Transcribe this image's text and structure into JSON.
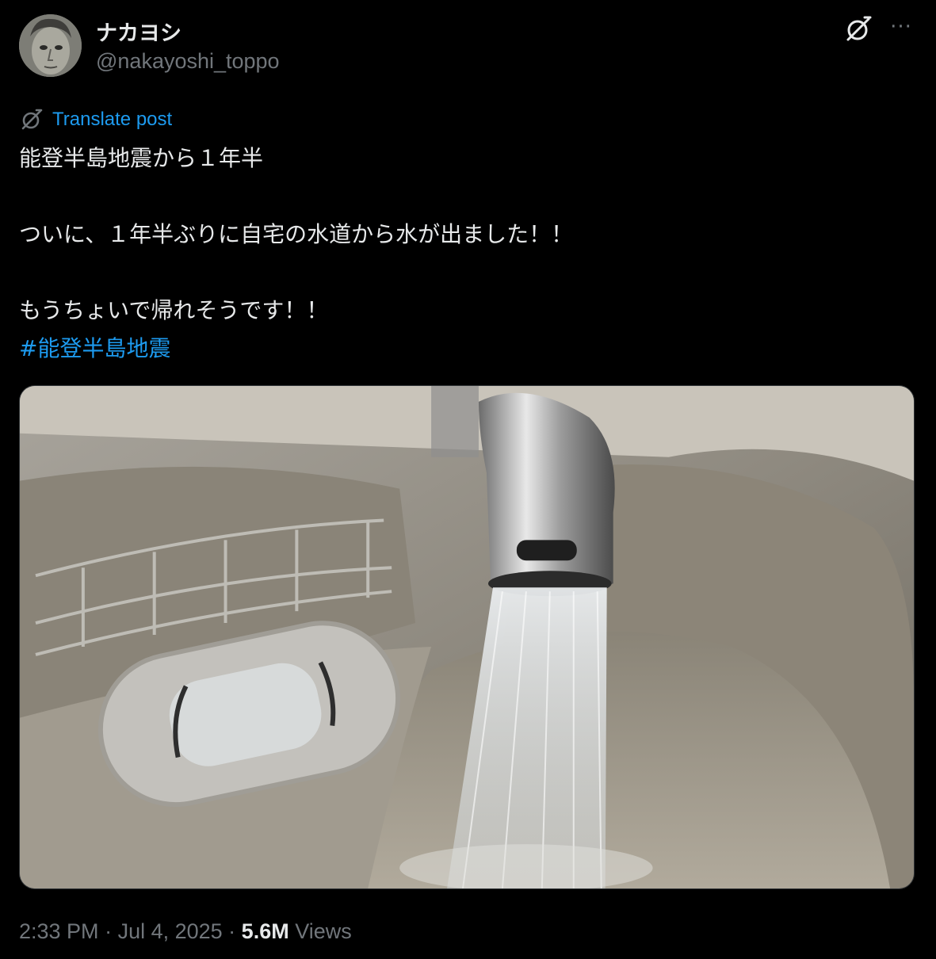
{
  "author": {
    "display_name": "ナカヨシ",
    "handle": "@nakayoshi_toppo",
    "avatar_icon": "avatar-portrait"
  },
  "header": {
    "grok_icon": "grok-icon",
    "more_icon": "more-horizontal-icon",
    "more_label": "···"
  },
  "translate": {
    "label": "Translate post",
    "icon": "grok-icon"
  },
  "post": {
    "line1": "能登半島地震から１年半",
    "line2": "ついに、１年半ぶりに自宅の水道から水が出ました！！",
    "line3": "もうちょいで帰れそうです！！",
    "hashtag": "#能登半島地震"
  },
  "media": {
    "description_icon": "photo-kitchen-sink-faucet"
  },
  "meta": {
    "time": "2:33 PM",
    "separator": " · ",
    "date": "Jul 4, 2025",
    "views_count": "5.6M",
    "views_label": " Views"
  },
  "colors": {
    "background": "#000000",
    "text": "#e7e9ea",
    "secondary": "#71767b",
    "accent": "#1d9bf0"
  }
}
